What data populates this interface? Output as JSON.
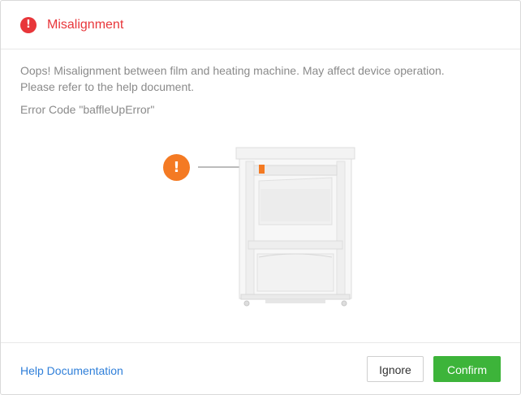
{
  "dialog": {
    "title": "Misalignment",
    "title_color": "#e8363a",
    "icon": "error-icon",
    "message_line1": "Oops! Misalignment between film and heating machine. May affect device operation.",
    "message_line2": "Please refer to the help document.",
    "error_code": "Error Code \"baffleUpError\""
  },
  "illustration": {
    "warning_icon": "warning-icon",
    "warning_color": "#f47a23",
    "device": "device-illustration"
  },
  "footer": {
    "help_label": "Help Documentation",
    "ignore_label": "Ignore",
    "confirm_label": "Confirm",
    "confirm_color": "#3db43a",
    "link_color": "#2f7fd9"
  }
}
